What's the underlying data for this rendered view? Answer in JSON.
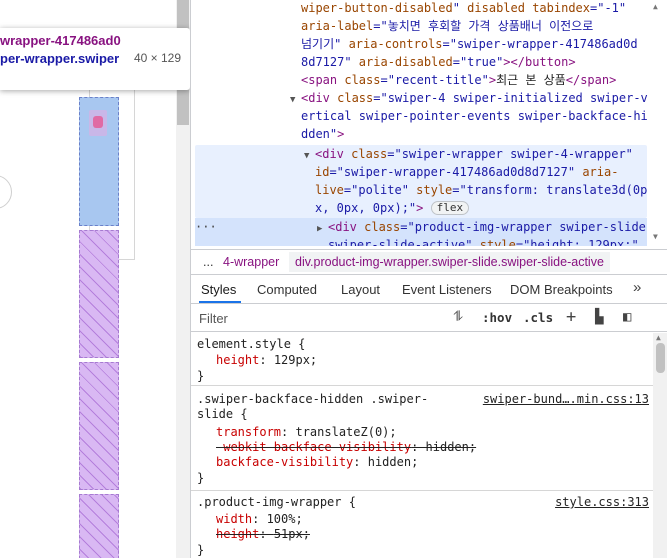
{
  "tooltip": {
    "line1": "wrapper-417486ad0",
    "line2": "per-wrapper.swiper",
    "dims": "40 × 129"
  },
  "tree": {
    "lines": [
      {
        "text_tag_open": "",
        "attr1": "wiper-button-disabled",
        "eq1": "\" ",
        "attr2": "disabled tabindex",
        "val2": "=\"-1\""
      },
      {
        "attr": "aria-label",
        "val": "=\"놓치면 후회할 가격 상품배너 이전으로"
      },
      {
        "val": "넘기기\" ",
        "attr": "aria-controls",
        "val2": "=\"swiper-wrapper-417486ad0d"
      },
      {
        "val": "8d7127\" ",
        "attr": "aria-disabled",
        "val2": "=\"true\"",
        "tag": "></button>"
      },
      {
        "tag_open": "<span ",
        "attr": "class",
        "val": "=\"recent-title\"",
        "tag_close": ">",
        "text": "최근 본 상품",
        "tag_end": "</span>"
      },
      {
        "tag": "<div ",
        "attr": "class",
        "val": "=\"swiper-4 swiper-initialized swiper-v"
      },
      {
        "val": "ertical swiper-pointer-events swiper-backface-hi"
      },
      {
        "val": "dden\"",
        "tag": ">"
      },
      {
        "tag": "<div ",
        "attr": "class",
        "val": "=\"swiper-wrapper swiper-4-wrapper\""
      },
      {
        "attr": "id",
        "val": "=\"swiper-wrapper-417486ad0d8d7127\" ",
        "attr2": "aria-"
      },
      {
        "attr": "live",
        "val": "=\"polite\" ",
        "attr2": "style",
        "val2": "=\"transform: translate3d(0p"
      },
      {
        "val": "x, 0px, 0px);\"",
        "tag": ">",
        "badge": "flex"
      },
      {
        "tag": "<div ",
        "attr": "class",
        "val": "=\"product-img-wrapper swiper-slide"
      },
      {
        "val": "swiper-slide-active\" ",
        "attr": "style",
        "val2": "=\"height: 129px;\""
      }
    ]
  },
  "breadcrumb": {
    "ellipsis": "...",
    "crumb1": "4-wrapper",
    "crumb2": "div.product-img-wrapper.swiper-slide.swiper-slide-active"
  },
  "tabs": [
    "Styles",
    "Computed",
    "Layout",
    "Event Listeners",
    "DOM Breakpoints"
  ],
  "tabs_more": "»",
  "filter": {
    "placeholder": "Filter",
    "hov": ":hov",
    "cls": ".cls",
    "plus": "+"
  },
  "styles": {
    "rule1": {
      "selector": "element.style {",
      "prop": "height",
      "value": "129px;",
      "close": "}"
    },
    "rule2": {
      "selector_a": ".swiper-backface-hidden .swiper-",
      "selector_b": "slide {",
      "source": "swiper-bund….min.css:13",
      "props": [
        {
          "prop": "transform",
          "value": "translateZ(0);",
          "struck": false
        },
        {
          "prop": "-webkit-backface-visibility",
          "value": "hidden;",
          "struck": true
        },
        {
          "prop": "backface-visibility",
          "value": "hidden;",
          "struck": false
        }
      ],
      "close": "}"
    },
    "rule3": {
      "selector": ".product-img-wrapper {",
      "source": "style.css:313",
      "props": [
        {
          "prop": "width",
          "value": "100%;",
          "struck": false
        },
        {
          "prop": "height",
          "value": "51px;",
          "struck": true
        }
      ],
      "close": "}"
    }
  },
  "colors": {
    "tag": "#881280",
    "attr": "#994500",
    "value": "#1a1aa6",
    "property": "#c80000",
    "accent": "#1a73e8"
  }
}
